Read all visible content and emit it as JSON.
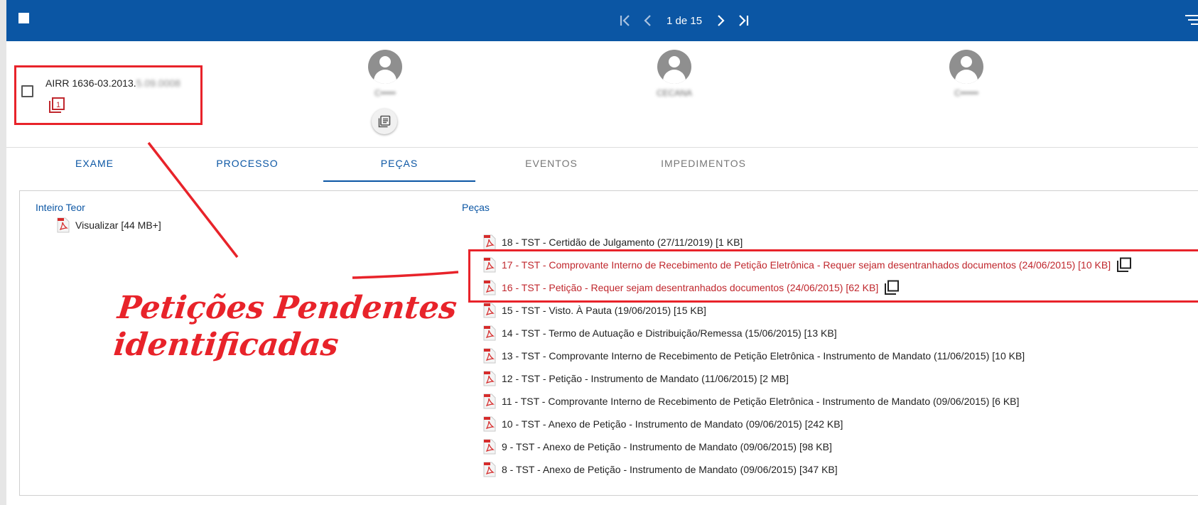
{
  "toolbar": {
    "pager_text": "1 de 15"
  },
  "process": {
    "number_visible": "AIRR 1636-03.2013.",
    "number_blurred": "5.09.0008",
    "copy_badge_count": "1"
  },
  "participants": [
    {
      "name": "C•••••"
    },
    {
      "name": "CECANA"
    },
    {
      "name": "C••••••"
    }
  ],
  "tabs": [
    {
      "label": "EXAME"
    },
    {
      "label": "PROCESSO"
    },
    {
      "label": "PEÇAS"
    },
    {
      "label": "EVENTOS"
    },
    {
      "label": "IMPEDIMENTOS"
    }
  ],
  "inteiro_teor": {
    "title": "Inteiro Teor",
    "link_label": "Visualizar",
    "size": "[44 MB+]"
  },
  "pecas": {
    "title": "Peças",
    "items": [
      {
        "text": "18 - TST - Certidão de Julgamento (27/11/2019) [1 KB]",
        "pending": false
      },
      {
        "text": "17 - TST - Comprovante Interno de Recebimento de Petição Eletrônica - Requer sejam desentranhados documentos (24/06/2015) [10 KB]",
        "pending": true
      },
      {
        "text": "16 - TST - Petição - Requer sejam desentranhados documentos (24/06/2015) [62 KB]",
        "pending": true
      },
      {
        "text": "15 - TST - Visto. À Pauta (19/06/2015) [15 KB]",
        "pending": false
      },
      {
        "text": "14 - TST - Termo de Autuação e Distribuição/Remessa (15/06/2015) [13 KB]",
        "pending": false
      },
      {
        "text": "13 - TST - Comprovante Interno de Recebimento de Petição Eletrônica - Instrumento de Mandato (11/06/2015) [10 KB]",
        "pending": false
      },
      {
        "text": "12 - TST - Petição - Instrumento de Mandato (11/06/2015) [2 MB]",
        "pending": false
      },
      {
        "text": "11 - TST - Comprovante Interno de Recebimento de Petição Eletrônica - Instrumento de Mandato (09/06/2015) [6 KB]",
        "pending": false
      },
      {
        "text": "10 - TST - Anexo de Petição - Instrumento de Mandato (09/06/2015) [242 KB]",
        "pending": false
      },
      {
        "text": "9 - TST - Anexo de Petição - Instrumento de Mandato (09/06/2015) [98 KB]",
        "pending": false
      },
      {
        "text": "8 - TST - Anexo de Petição - Instrumento de Mandato (09/06/2015) [347 KB]",
        "pending": false
      }
    ]
  },
  "annotation": {
    "line1": "Petições Pendentes",
    "line2": "identificadas"
  },
  "colors": {
    "brand_blue": "#0b56a4",
    "pending_red": "#c0272d",
    "annotation_red": "#e8232a"
  },
  "icons": [
    "first-page-icon",
    "previous-page-icon",
    "next-page-icon",
    "last-page-icon",
    "sort-menu-icon",
    "copy-icon",
    "person-icon",
    "notes-icon",
    "pdf-icon"
  ]
}
